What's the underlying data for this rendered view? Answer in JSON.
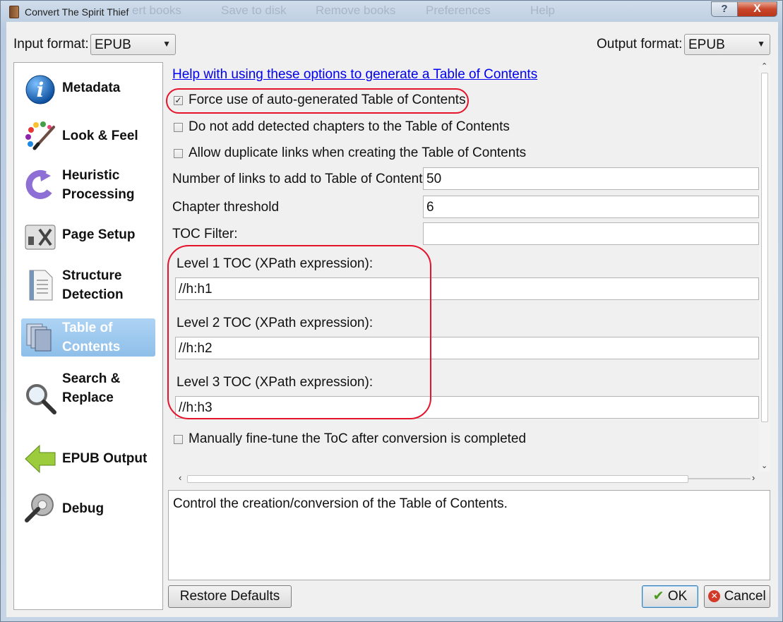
{
  "window": {
    "title": "Convert The Spirit Thief",
    "background_menu": [
      "ert books",
      "Save to disk",
      "Remove books",
      "Preferences",
      "Help"
    ],
    "help_button": "?",
    "close_button": "X"
  },
  "formats": {
    "input_label": "Input format:",
    "input_value": "EPUB",
    "output_label": "Output format:",
    "output_value": "EPUB"
  },
  "sidebar": {
    "items": [
      {
        "label": "Metadata",
        "icon": "info-icon"
      },
      {
        "label": "Look & Feel",
        "icon": "palette-icon"
      },
      {
        "label": "Heuristic Processing",
        "icon": "heuristic-arrow-icon"
      },
      {
        "label": "Page Setup",
        "icon": "page-setup-tools-icon"
      },
      {
        "label": "Structure Detection",
        "icon": "document-icon"
      },
      {
        "label": "Table of Contents",
        "icon": "toc-pages-icon",
        "selected": true
      },
      {
        "label": "Search & Replace",
        "icon": "magnifier-icon"
      },
      {
        "label": "EPUB Output",
        "icon": "back-arrow-icon"
      },
      {
        "label": "Debug",
        "icon": "debug-gear-icon"
      }
    ]
  },
  "toc": {
    "help_link": "Help with using these options to generate a Table of Contents",
    "force_auto": {
      "label": "Force use of auto-generated Table of Contents",
      "checked": true
    },
    "no_detected": {
      "label": "Do not add detected chapters to the Table of Contents",
      "checked": false
    },
    "allow_duplicates": {
      "label": "Allow duplicate links when creating the Table of Contents",
      "checked": false
    },
    "num_links": {
      "label": "Number of links to add to Table of Contents",
      "value": "50"
    },
    "chapter_threshold": {
      "label": "Chapter threshold",
      "value": "6"
    },
    "toc_filter": {
      "label": "TOC Filter:",
      "value": ""
    },
    "level1": {
      "label": "Level 1 TOC (XPath expression):",
      "value": "//h:h1"
    },
    "level2": {
      "label": "Level 2 TOC (XPath expression):",
      "value": "//h:h2"
    },
    "level3": {
      "label": "Level 3 TOC (XPath expression):",
      "value": "//h:h3"
    },
    "manual_tune": {
      "label": "Manually fine-tune the ToC after conversion is completed",
      "checked": false
    }
  },
  "description": "Control the creation/conversion of the Table of Contents.",
  "buttons": {
    "restore": "Restore Defaults",
    "ok": "OK",
    "cancel": "Cancel"
  },
  "colors": {
    "link": "#0000ee",
    "highlight_annotation": "#e3142b",
    "selected_nav": "#9cc8ef"
  }
}
